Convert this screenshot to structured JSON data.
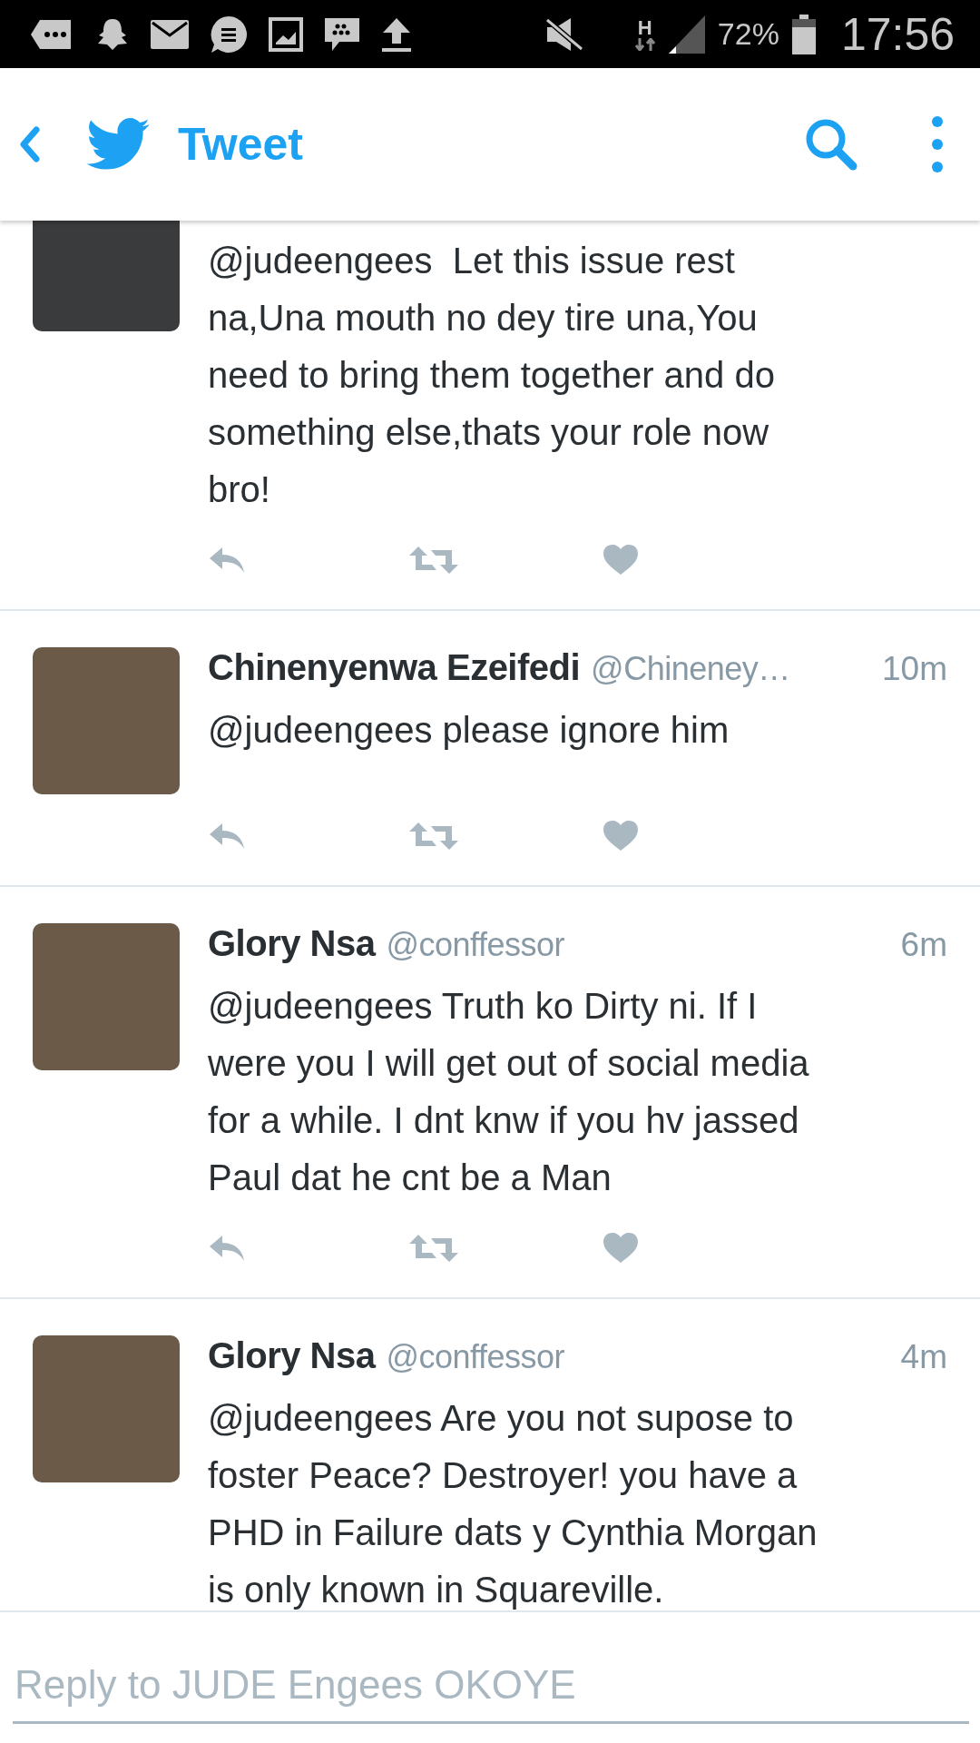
{
  "status_bar": {
    "network": "H",
    "battery": "72%",
    "time": "17:56"
  },
  "header": {
    "title": "Tweet"
  },
  "tweets": [
    {
      "kind": "partial",
      "text": "@judeengees  Let this issue rest\nna,Una mouth no dey tire una,You\nneed to bring them together and do\nsomething else,thats your role now\nbro!"
    },
    {
      "kind": "full",
      "name": "Chinenyenwa Ezeifedi",
      "handle": "@Chineney…",
      "time": "10m",
      "text": "@judeengees please ignore him"
    },
    {
      "kind": "full",
      "name": "Glory Nsa",
      "handle": "@conffessor",
      "time": "6m",
      "text": "@judeengees Truth ko Dirty ni. If I\nwere you I will get out of social media\nfor a while. I dnt knw if you hv jassed\nPaul dat he cnt be a Man"
    },
    {
      "kind": "clipped",
      "name": "Glory Nsa",
      "handle": "@conffessor",
      "time": "4m",
      "text": "@judeengees Are you not supose to\nfoster Peace? Destroyer! you have a\nPHD in Failure dats y Cynthia Morgan\nis only known in Squareville."
    }
  ],
  "reply": {
    "placeholder": "Reply to JUDE Engees OKOYE"
  }
}
